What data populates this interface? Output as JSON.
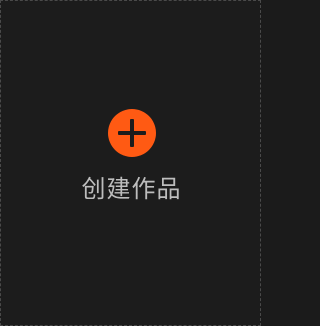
{
  "create_card": {
    "label": "创建作品",
    "icon": "plus-circle-icon",
    "accent_color": "#ff5a13",
    "background_color": "#1c1c1c",
    "text_color": "#bdbdbd"
  }
}
